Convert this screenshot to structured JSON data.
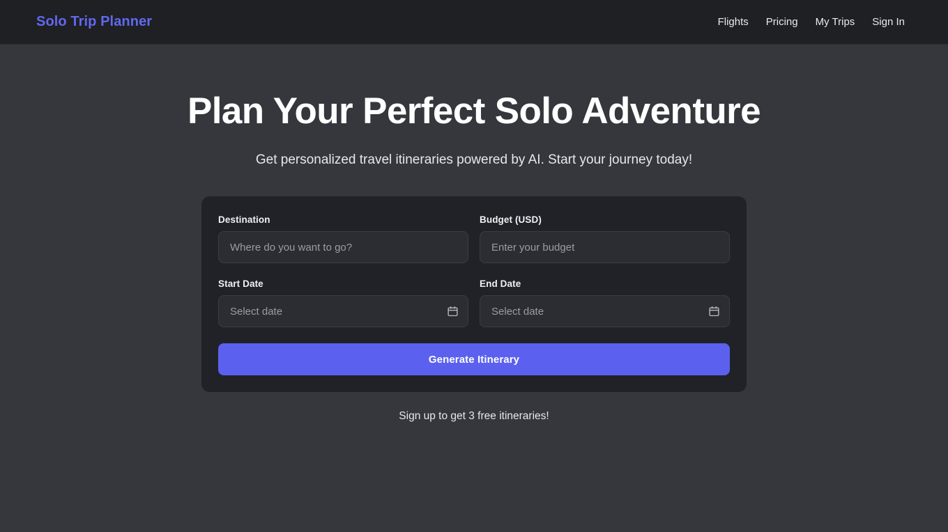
{
  "header": {
    "brand": "Solo Trip Planner",
    "nav": [
      {
        "label": "Flights"
      },
      {
        "label": "Pricing"
      },
      {
        "label": "My Trips"
      },
      {
        "label": "Sign In"
      }
    ]
  },
  "hero": {
    "title": "Plan Your Perfect Solo Adventure",
    "subtitle": "Get personalized travel itineraries powered by AI. Start your journey today!"
  },
  "form": {
    "destination": {
      "label": "Destination",
      "placeholder": "Where do you want to go?",
      "value": ""
    },
    "budget": {
      "label": "Budget (USD)",
      "placeholder": "Enter your budget",
      "value": ""
    },
    "start_date": {
      "label": "Start Date",
      "placeholder": "Select date",
      "value": "",
      "icon": "calendar-icon"
    },
    "end_date": {
      "label": "End Date",
      "placeholder": "Select date",
      "value": "",
      "icon": "calendar-icon"
    },
    "submit_label": "Generate Itinerary"
  },
  "footnote": "Sign up to get 3 free itineraries!",
  "colors": {
    "page_background": "#35373c",
    "header_background": "#1e2024",
    "card_background": "#202227",
    "input_background": "#2b2d33",
    "brand_accent": "#6268ee",
    "primary_button": "#5b61ee",
    "text_primary": "#ffffff",
    "text_muted": "#9a9da4"
  }
}
